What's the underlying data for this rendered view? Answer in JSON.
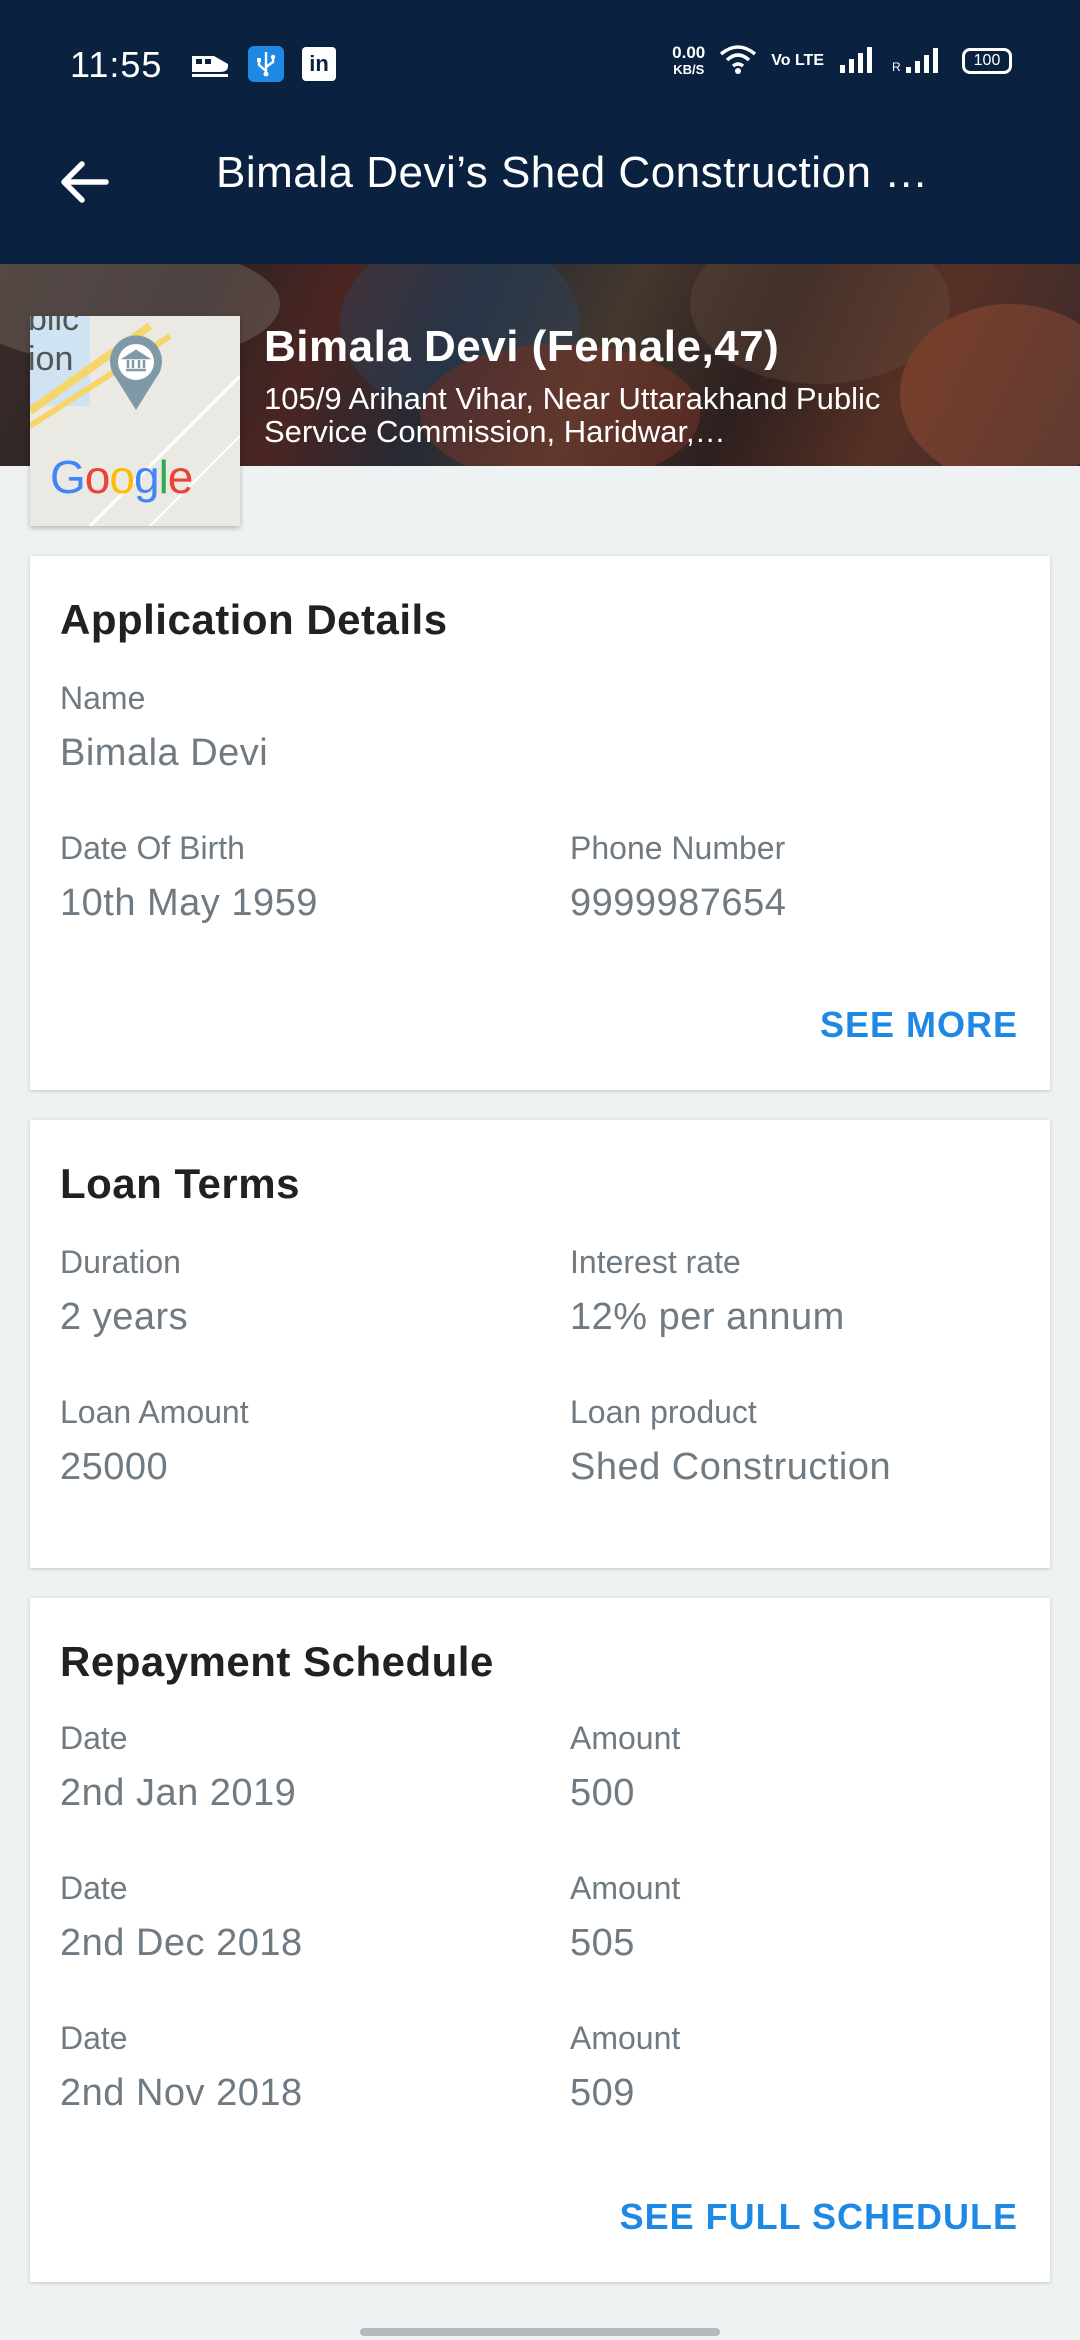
{
  "status_bar": {
    "time": "11:55",
    "net_speed_value": "0.00",
    "net_speed_unit": "KB/S",
    "volte": "Vo LTE",
    "battery": "100"
  },
  "app_bar": {
    "title": "Bimala Devi’s Shed Construction …"
  },
  "banner": {
    "name": "Bimala Devi (Female,47)",
    "address": "105/9  Arihant  Vihar,  Near  Uttarakhand Public Service Commission, Haridwar,…",
    "map_fragment_text": "blic ion",
    "map_brand": "Google"
  },
  "application_details": {
    "title": "Application Details",
    "name_label": "Name",
    "name_value": "Bimala Devi",
    "dob_label": "Date Of Birth",
    "dob_value": "10th May 1959",
    "phone_label": "Phone Number",
    "phone_value": "9999987654",
    "see_more": "SEE MORE"
  },
  "loan_terms": {
    "title": "Loan Terms",
    "duration_label": "Duration",
    "duration_value": "2 years",
    "interest_label": "Interest rate",
    "interest_value": "12% per annum",
    "amount_label": "Loan Amount",
    "amount_value": "25000",
    "product_label": "Loan product",
    "product_value": "Shed Construction"
  },
  "repayment_schedule": {
    "title": "Repayment Schedule",
    "rows": [
      {
        "date_label": "Date",
        "date": "2nd Jan 2019",
        "amount_label": "Amount",
        "amount": "500"
      },
      {
        "date_label": "Date",
        "date": "2nd Dec 2018",
        "amount_label": "Amount",
        "amount": "505"
      },
      {
        "date_label": "Date",
        "date": "2nd Nov 2018",
        "amount_label": "Amount",
        "amount": "509"
      }
    ],
    "see_full": "SEE FULL SCHEDULE"
  },
  "colors": {
    "app_bar": "#0a2240",
    "accent": "#1e88e5",
    "background": "#eef2f2",
    "secondary_text": "#707a82"
  }
}
